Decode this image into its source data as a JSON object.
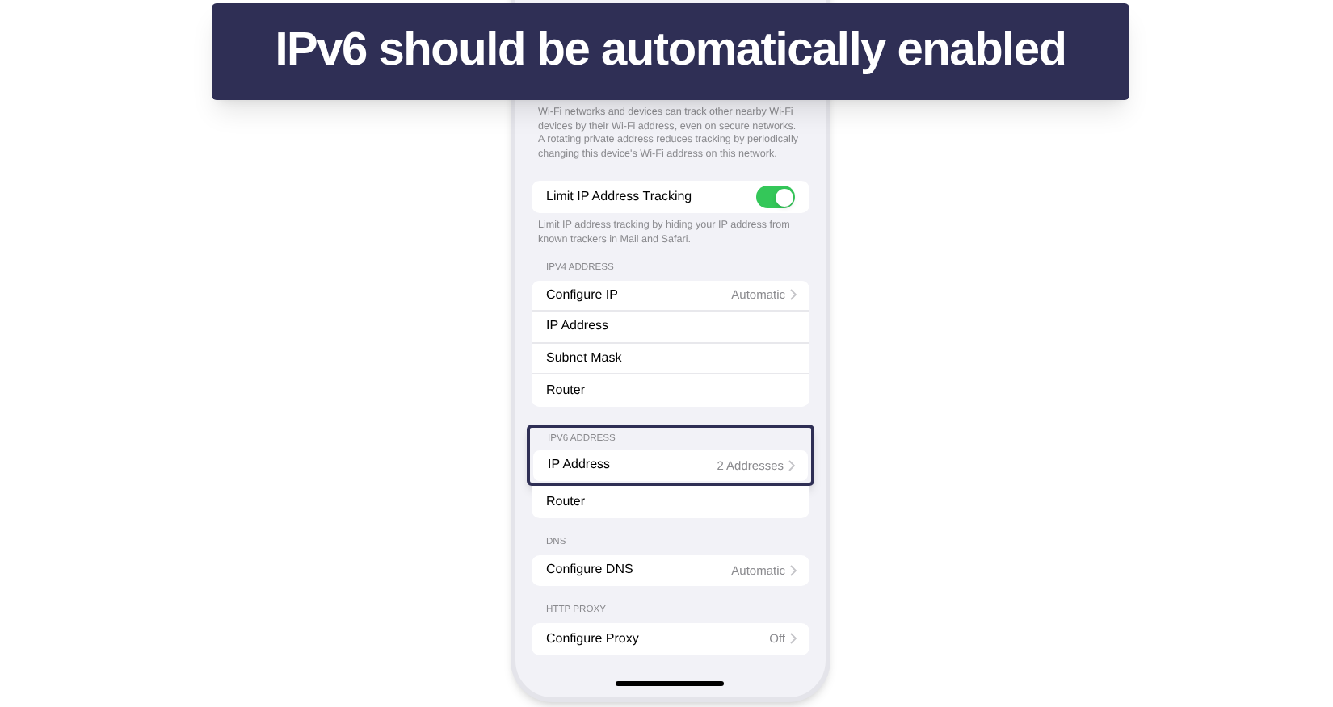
{
  "banner": {
    "title": "IPv6 should be automatically enabled"
  },
  "intro": "Wi-Fi networks and devices can track other nearby Wi-Fi devices by their Wi-Fi address, even on secure networks. A rotating private address reduces tracking by periodically changing this device's Wi-Fi address on this network.",
  "tracking": {
    "label": "Limit IP Address Tracking",
    "on": true,
    "footer": "Limit IP address tracking by hiding your IP address from known trackers in Mail and Safari."
  },
  "sections": [
    {
      "header": "IPV4 ADDRESS",
      "highlighted": false,
      "rows": [
        {
          "label": "Configure IP",
          "value": "Automatic",
          "chevron": true
        },
        {
          "label": "IP Address",
          "chevron": false
        },
        {
          "label": "Subnet Mask",
          "chevron": false
        },
        {
          "label": "Router",
          "chevron": false
        }
      ]
    },
    {
      "header": "IPV6 ADDRESS",
      "highlighted": true,
      "rows": [
        {
          "label": "IP Address",
          "value": "2 Addresses",
          "chevron": true
        },
        {
          "label": "Router",
          "chevron": false
        }
      ]
    },
    {
      "header": "DNS",
      "highlighted": false,
      "rows": [
        {
          "label": "Configure DNS",
          "value": "Automatic",
          "chevron": true
        }
      ]
    },
    {
      "header": "HTTP PROXY",
      "highlighted": false,
      "rows": [
        {
          "label": "Configure Proxy",
          "value": "Off",
          "chevron": true
        }
      ]
    }
  ]
}
